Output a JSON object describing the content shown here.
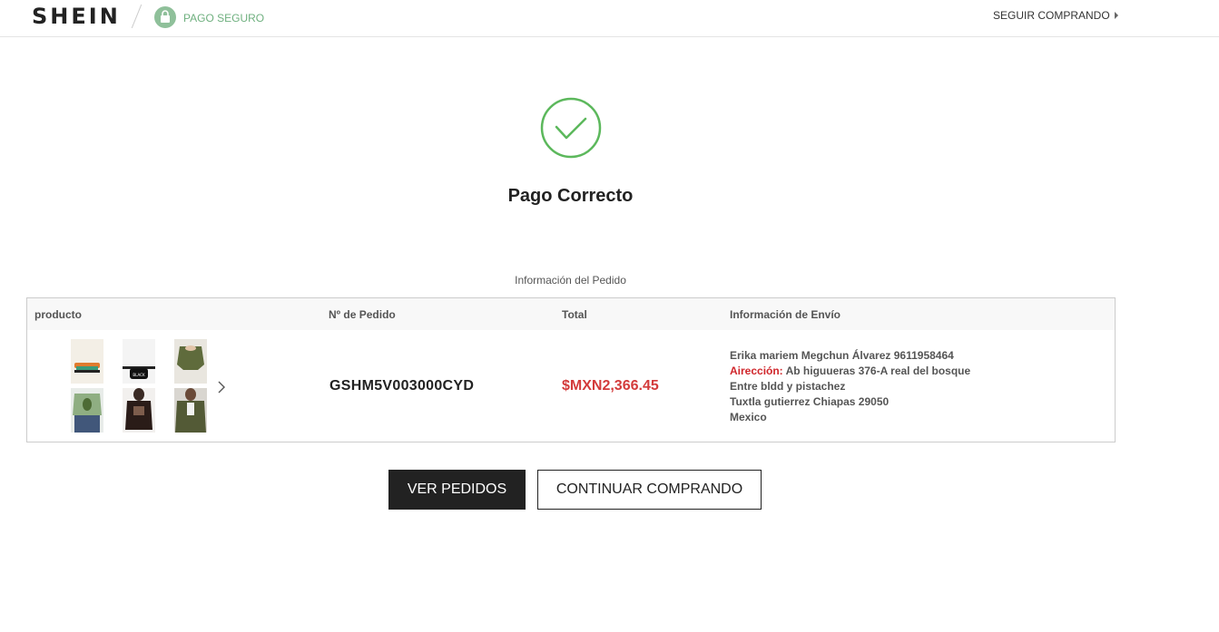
{
  "header": {
    "logo": "SHEIN",
    "secure_label": "PAGO SEGURO",
    "keep_shopping": "SEGUIR COMPRANDO"
  },
  "success": {
    "title": "Pago Correcto",
    "icon": "check-circle-icon",
    "accent_color": "#5cb85c"
  },
  "order": {
    "section_title": "Información del Pedido",
    "columns": {
      "product": "producto",
      "order_no": "Nº de Pedido",
      "total": "Total",
      "shipping": "Información de Envío"
    },
    "products": [
      {
        "name": "product-thumb-1",
        "desc": "slide sandals"
      },
      {
        "name": "product-thumb-2",
        "desc": "black bum bag"
      },
      {
        "name": "product-thumb-3",
        "desc": "olive twist crop top"
      },
      {
        "name": "product-thumb-4",
        "desc": "avocado print tee"
      },
      {
        "name": "product-thumb-5",
        "desc": "black mesh top"
      },
      {
        "name": "product-thumb-6",
        "desc": "olive jacket"
      }
    ],
    "order_number": "GSHM5V003000CYD",
    "total": "$MXN2,366.45",
    "total_color": "#d33b3b",
    "shipping": {
      "name_phone": "Erika mariem Megchun Álvarez 9611958464",
      "address_label": "Airección:",
      "address_line1": "Ab higuueras 376-A real del bosque",
      "address_line2": "Entre bldd y pistachez",
      "city_line": "Tuxtla gutierrez Chiapas 29050",
      "country": "Mexico"
    }
  },
  "buttons": {
    "view_orders": "VER PEDIDOS",
    "continue_shopping": "CONTINUAR COMPRANDO"
  }
}
